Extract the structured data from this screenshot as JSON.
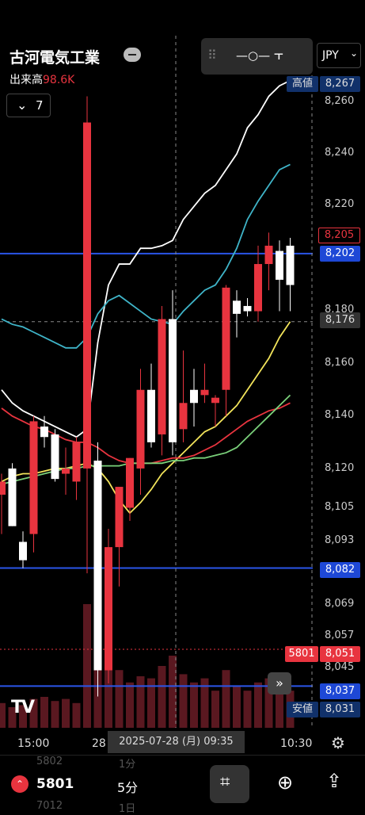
{
  "header": {
    "company_name": "古河電気工業",
    "volume_label": "出来高",
    "volume_value": "98.6K",
    "timeframe_count": "7",
    "currency": "JPY"
  },
  "price_axis": {
    "ticks": [
      "8,260",
      "8,240",
      "8,220",
      "8,180",
      "8,160",
      "8,140",
      "8,120",
      "8,105",
      "8,093",
      "8,069",
      "8,057",
      "8,045"
    ],
    "high_label": "高値",
    "high_value": "8,267",
    "low_label": "安値",
    "low_value": "8,031",
    "last_price": "8,205",
    "line_upper": "8,202",
    "crosshair_price": "8,176",
    "line_lower": "8,082",
    "current_price": "8,051",
    "current_volume": "5801",
    "line_bottom": "8,037"
  },
  "time_axis": {
    "ticks": [
      "15:00",
      "28",
      "10:30"
    ],
    "crosshair_time": "2025-07-28 (月)  09:35"
  },
  "bottom_bar": {
    "price_value": "5801",
    "scroll_above": "5802",
    "scroll_below": "7012",
    "interval_above": "1分",
    "interval": "5分",
    "interval_below": "1日"
  },
  "chart_data": {
    "type": "candlestick",
    "ylim": [
      8025,
      8270
    ],
    "candles": [
      {
        "o": 8110,
        "h": 8118,
        "l": 8095,
        "c": 8115
      },
      {
        "o": 8120,
        "h": 8122,
        "l": 8098,
        "c": 8098
      },
      {
        "o": 8092,
        "h": 8096,
        "l": 8082,
        "c": 8085
      },
      {
        "o": 8095,
        "h": 8140,
        "l": 8088,
        "c": 8138
      },
      {
        "o": 8136,
        "h": 8140,
        "l": 8128,
        "c": 8132
      },
      {
        "o": 8133,
        "h": 8135,
        "l": 8115,
        "c": 8116
      },
      {
        "o": 8118,
        "h": 8128,
        "l": 8110,
        "c": 8120
      },
      {
        "o": 8115,
        "h": 8132,
        "l": 8108,
        "c": 8130
      },
      {
        "o": 8120,
        "h": 8262,
        "l": 8080,
        "c": 8252
      },
      {
        "o": 8123,
        "h": 8130,
        "l": 8033,
        "c": 8043
      },
      {
        "o": 8043,
        "h": 8097,
        "l": 8038,
        "c": 8090
      },
      {
        "o": 8090,
        "h": 8100,
        "l": 8075,
        "c": 8113
      },
      {
        "o": 8105,
        "h": 8124,
        "l": 8100,
        "c": 8124
      },
      {
        "o": 8120,
        "h": 8158,
        "l": 8110,
        "c": 8150
      },
      {
        "o": 8150,
        "h": 8160,
        "l": 8128,
        "c": 8130
      },
      {
        "o": 8133,
        "h": 8182,
        "l": 8125,
        "c": 8177
      },
      {
        "o": 8177,
        "h": 8188,
        "l": 8125,
        "c": 8130
      },
      {
        "o": 8135,
        "h": 8165,
        "l": 8130,
        "c": 8145
      },
      {
        "o": 8150,
        "h": 8158,
        "l": 8136,
        "c": 8145
      },
      {
        "o": 8148,
        "h": 8160,
        "l": 8145,
        "c": 8150
      },
      {
        "o": 8145,
        "h": 8148,
        "l": 8136,
        "c": 8147
      },
      {
        "o": 8150,
        "h": 8190,
        "l": 8140,
        "c": 8189
      },
      {
        "o": 8184,
        "h": 8188,
        "l": 8170,
        "c": 8179
      },
      {
        "o": 8182,
        "h": 8185,
        "l": 8178,
        "c": 8180
      },
      {
        "o": 8180,
        "h": 8205,
        "l": 8176,
        "c": 8198
      },
      {
        "o": 8198,
        "h": 8210,
        "l": 8188,
        "c": 8205
      },
      {
        "o": 8203,
        "h": 8207,
        "l": 8180,
        "c": 8192
      },
      {
        "o": 8205,
        "h": 8208,
        "l": 8180,
        "c": 8190
      }
    ],
    "volumes": [
      12,
      10,
      11,
      14,
      15,
      13,
      14,
      12,
      60,
      70,
      40,
      28,
      22,
      25,
      24,
      30,
      35,
      26,
      22,
      24,
      18,
      28,
      20,
      18,
      22,
      24,
      20,
      18
    ],
    "series": [
      {
        "values": [
          8150,
          8145,
          8142,
          8140,
          8138,
          8136,
          8134,
          8132,
          8135,
          8168,
          8190,
          8198,
          8198,
          8204,
          8204,
          8205,
          8207,
          8215,
          8220,
          8225,
          8228,
          8234,
          8240,
          8250,
          8255,
          8262,
          8266,
          8268
        ],
        "color": "#ffffff"
      },
      {
        "values": [
          8177,
          8175,
          8174,
          8172,
          8170,
          8168,
          8166,
          8166,
          8170,
          8179,
          8184,
          8186,
          8183,
          8180,
          8177,
          8176,
          8175,
          8180,
          8184,
          8188,
          8190,
          8196,
          8204,
          8215,
          8222,
          8228,
          8234,
          8236
        ],
        "color": "#3fb4c8"
      },
      {
        "values": [
          8115,
          8117,
          8118,
          8118,
          8119,
          8120,
          8120,
          8121,
          8122,
          8120,
          8115,
          8108,
          8103,
          8107,
          8112,
          8118,
          8122,
          8126,
          8130,
          8134,
          8136,
          8140,
          8144,
          8150,
          8156,
          8162,
          8170,
          8176
        ],
        "color": "#f2e45b"
      },
      {
        "values": [
          8143,
          8140,
          8138,
          8136,
          8135,
          8133,
          8131,
          8130,
          8130,
          8128,
          8125,
          8123,
          8122,
          8122,
          8122,
          8123,
          8124,
          8124,
          8125,
          8127,
          8129,
          8132,
          8135,
          8138,
          8140,
          8142,
          8143,
          8145
        ],
        "color": "#e8343f"
      },
      {
        "values": [
          8114,
          8115,
          8116,
          8117,
          8118,
          8119,
          8120,
          8120,
          8121,
          8121,
          8121,
          8121,
          8122,
          8122,
          8122,
          8122,
          8123,
          8123,
          8124,
          8124,
          8125,
          8126,
          8128,
          8132,
          8136,
          8140,
          8144,
          8148
        ],
        "color": "#7ad07a"
      }
    ]
  }
}
